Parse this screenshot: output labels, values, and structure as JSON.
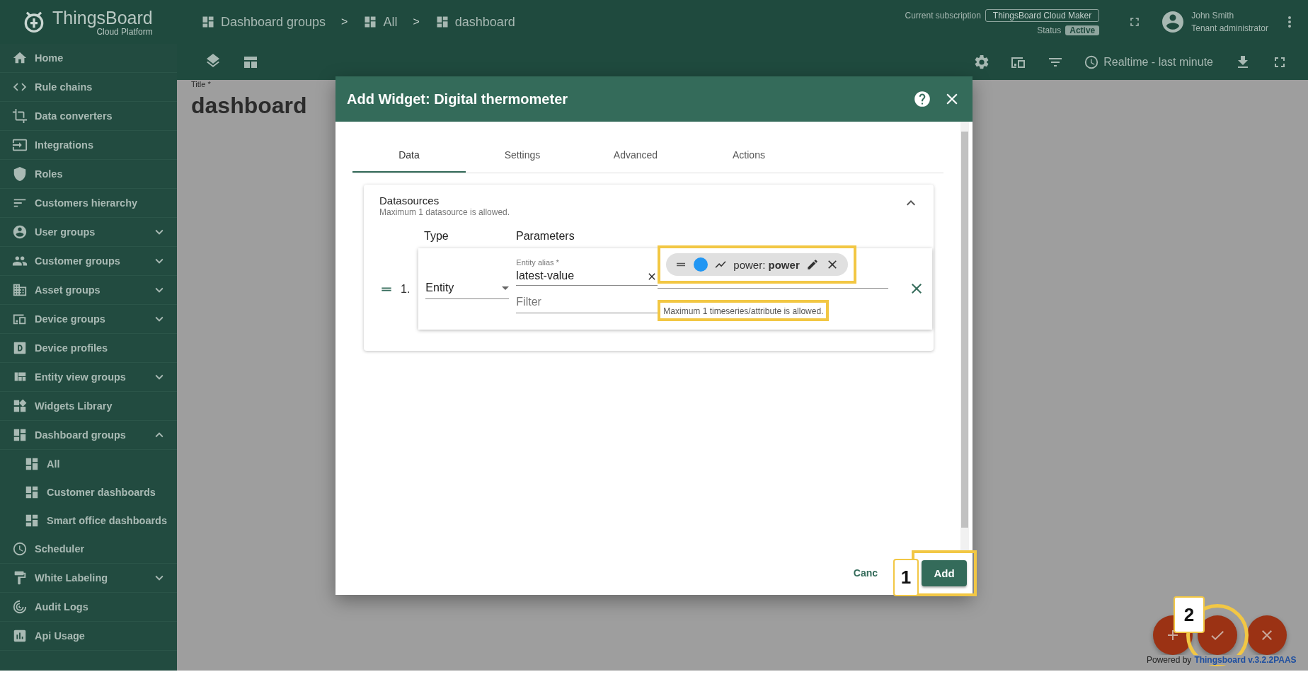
{
  "header": {
    "logo_title": "ThingsBoard",
    "logo_subtitle": "Cloud Platform",
    "breadcrumbs": [
      {
        "label": "Dashboard groups"
      },
      {
        "separator": ">",
        "label": "All"
      },
      {
        "separator": ">",
        "label": "dashboard"
      }
    ],
    "subscription_label": "Current subscription",
    "subscription": "ThingsBoard Cloud Maker",
    "status_label": "Status",
    "status": "Active",
    "user_name": "John Smith",
    "user_role": "Tenant administrator"
  },
  "toolbar": {
    "timewindow": "Realtime - last minute"
  },
  "sidebar": {
    "items": [
      {
        "label": "Home"
      },
      {
        "label": "Rule chains"
      },
      {
        "label": "Data converters"
      },
      {
        "label": "Integrations"
      },
      {
        "label": "Roles"
      },
      {
        "label": "Customers hierarchy"
      },
      {
        "label": "User groups",
        "expanded": false
      },
      {
        "label": "Customer groups",
        "expanded": false
      },
      {
        "label": "Asset groups",
        "expanded": false
      },
      {
        "label": "Device groups",
        "expanded": false
      },
      {
        "label": "Device profiles"
      },
      {
        "label": "Entity view groups",
        "expanded": false
      },
      {
        "label": "Widgets Library"
      },
      {
        "label": "Dashboard groups",
        "expanded": true,
        "children": [
          {
            "label": "All"
          },
          {
            "label": "Customer dashboards"
          },
          {
            "label": "Smart office dashboards"
          }
        ]
      },
      {
        "label": "Scheduler"
      },
      {
        "label": "White Labeling",
        "expanded": false
      },
      {
        "label": "Audit Logs"
      },
      {
        "label": "Api Usage"
      }
    ]
  },
  "page": {
    "title_label": "Title *",
    "title": "dashboard"
  },
  "dialog": {
    "title": "Add Widget: Digital thermometer",
    "tabs": [
      {
        "label": "Data",
        "selected": true
      },
      {
        "label": "Settings",
        "selected": false
      },
      {
        "label": "Advanced",
        "selected": false
      },
      {
        "label": "Actions",
        "selected": false
      }
    ],
    "datasources": {
      "title": "Datasources",
      "subtitle": "Maximum 1 datasource is allowed.",
      "columns": [
        "Type",
        "Parameters"
      ],
      "rows": [
        {
          "index": "1.",
          "type": "Entity",
          "alias_label": "Entity alias *",
          "alias": "latest-value",
          "filter_placeholder": "Filter",
          "data_keys": [
            {
              "label": "power: **power**",
              "color": "#2196f3"
            }
          ],
          "hint": "Maximum 1 timeseries/attribute is allowed."
        }
      ]
    },
    "buttons": [
      {
        "label": "Canc",
        "kind": "text"
      },
      {
        "label": "Add",
        "kind": "primary"
      }
    ]
  },
  "callouts": [
    {
      "label": "1"
    },
    {
      "label": "2"
    }
  ],
  "footer": {
    "powered_by": "Powered by",
    "link": "Thingsboard v.3.2.2PAAS"
  }
}
